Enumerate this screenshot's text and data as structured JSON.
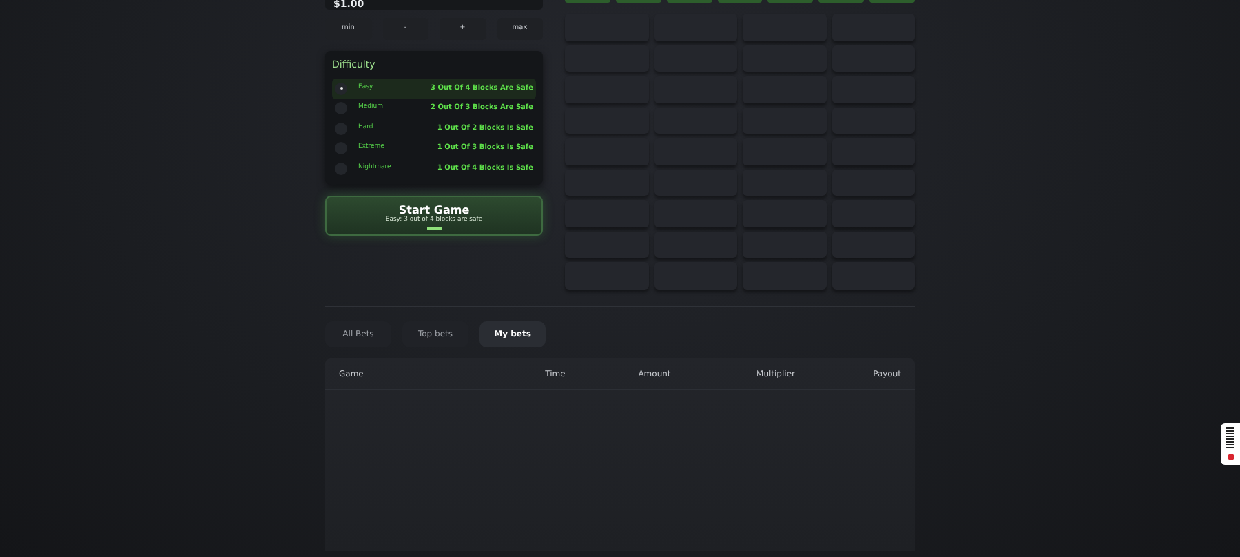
{
  "bet_amount": {
    "value": "$1.00"
  },
  "amount_buttons": [
    "min",
    "-",
    "+",
    "max"
  ],
  "difficulty": {
    "title": "Difficulty",
    "options": [
      {
        "label": "Easy",
        "description": "3 Out Of 4 Blocks Are Safe",
        "selected": true
      },
      {
        "label": "Medium",
        "description": "2 Out Of 3 Blocks Are Safe",
        "selected": false
      },
      {
        "label": "Hard",
        "description": "1 Out Of 2 Blocks Is Safe",
        "selected": false
      },
      {
        "label": "Extreme",
        "description": "1 Out Of 3 Blocks Is Safe",
        "selected": false
      },
      {
        "label": "Nightmare",
        "description": "1 Out Of 4 Blocks Is Safe",
        "selected": false
      }
    ]
  },
  "start_button": {
    "label": "Start Game",
    "subtitle": "Easy: 3 out of 4 blocks are safe"
  },
  "bet_tabs": [
    {
      "label": "All Bets",
      "selected": false
    },
    {
      "label": "Top bets",
      "selected": false
    },
    {
      "label": "My bets",
      "selected": true
    }
  ],
  "table": {
    "columns": [
      "Game",
      "Time",
      "Amount",
      "Multiplier",
      "Payout"
    ]
  }
}
